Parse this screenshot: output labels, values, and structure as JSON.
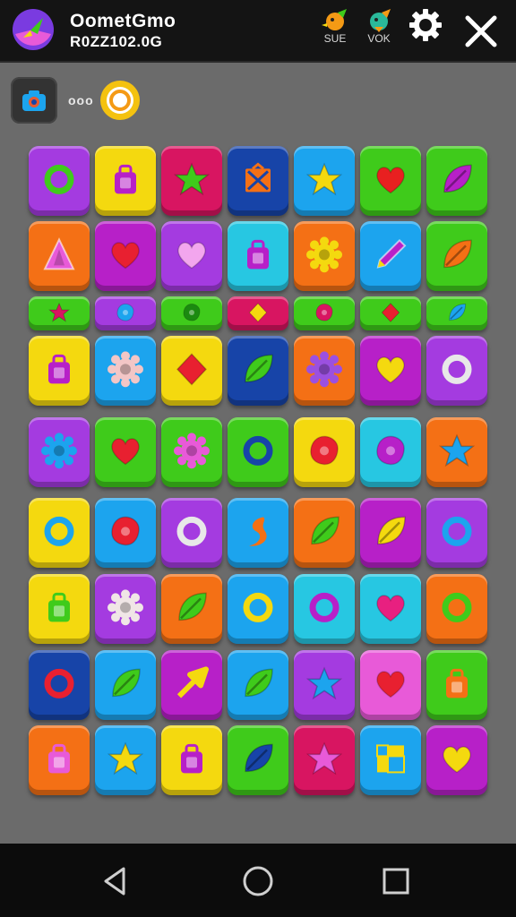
{
  "header": {
    "title": "OometGmo",
    "subtitle": "R0ZZ102.0G",
    "buttons": [
      {
        "name": "sue-button",
        "label": "SUE",
        "icon": "orange-bird-icon"
      },
      {
        "name": "vok-button",
        "label": "VOK",
        "icon": "teal-bird-icon"
      },
      {
        "name": "settings-button",
        "label": "",
        "icon": "gear-icon"
      }
    ],
    "close_icon": "close-icon"
  },
  "toolbar": {
    "camera_icon": "camera-icon",
    "dots": "ooo",
    "coin_icon": "coin-icon"
  },
  "colors": {
    "purple": "#a43be0",
    "yellow": "#f4d90f",
    "crimson": "#d81561",
    "navy": "#1744a8",
    "sky": "#1ca4ee",
    "green": "#3fcb1b",
    "orange": "#f47015",
    "magenta": "#b720c8",
    "pink": "#e85ad8",
    "cyan": "#27c7e2"
  },
  "board": {
    "rows": [
      {
        "thin": false,
        "tiles": [
          [
            "purple",
            "ring",
            "#3fcb1b"
          ],
          [
            "yellow",
            "bag",
            "#b720c8"
          ],
          [
            "crimson",
            "star",
            "#3fcb1b"
          ],
          [
            "navy",
            "box",
            "#f47015"
          ],
          [
            "sky",
            "star",
            "#f4d90f"
          ],
          [
            "green",
            "heart",
            "#e82020"
          ],
          [
            "green",
            "leaf",
            "#b720c8"
          ]
        ]
      },
      {
        "thin": false,
        "tiles": [
          [
            "orange",
            "triangle",
            "#e85ad8"
          ],
          [
            "magenta",
            "heart",
            "#e82030"
          ],
          [
            "purple",
            "heart",
            "#f3a6ee"
          ],
          [
            "cyan",
            "bag",
            "#b720c8"
          ],
          [
            "orange",
            "gear",
            "#f4d90f"
          ],
          [
            "sky",
            "pencil",
            "#b720c8"
          ],
          [
            "green",
            "leaf",
            "#f47015"
          ]
        ]
      },
      {
        "thin": true,
        "tiles": [
          [
            "green",
            "star",
            "#d81561"
          ],
          [
            "purple",
            "blob",
            "#1ca4ee"
          ],
          [
            "green",
            "blob",
            "#1b8a10"
          ],
          [
            "crimson",
            "diamond",
            "#f4d90f"
          ],
          [
            "green",
            "blob",
            "#d81561"
          ],
          [
            "green",
            "diamond",
            "#e82030"
          ],
          [
            "green",
            "leaf",
            "#1ca4ee"
          ]
        ]
      },
      {
        "thin": false,
        "tiles": [
          [
            "yellow",
            "bag",
            "#b720c8"
          ],
          [
            "sky",
            "gear",
            "#f3c6c6"
          ],
          [
            "yellow",
            "diamond",
            "#e82030"
          ],
          [
            "navy",
            "leaf",
            "#3fcb1b"
          ],
          [
            "orange",
            "gear",
            "#9b50e0"
          ],
          [
            "magenta",
            "heart",
            "#f4d90f"
          ],
          [
            "purple",
            "ring",
            "#e8e8e8"
          ]
        ]
      },
      {
        "thin": false,
        "tiles": [
          [
            "purple",
            "gear",
            "#1ca4ee"
          ],
          [
            "green",
            "heart",
            "#e82030"
          ],
          [
            "green",
            "gear",
            "#e85ad8"
          ],
          [
            "green",
            "ring",
            "#1744a8"
          ],
          [
            "yellow",
            "blob",
            "#e82030"
          ],
          [
            "cyan",
            "blob",
            "#b720c8"
          ],
          [
            "orange",
            "star",
            "#1ca4ee"
          ]
        ]
      },
      {
        "thin": false,
        "tiles": [
          [
            "yellow",
            "ring",
            "#1ca4ee"
          ],
          [
            "sky",
            "blob",
            "#e82030"
          ],
          [
            "purple",
            "ring",
            "#e8e8e8"
          ],
          [
            "sky",
            "swirl",
            "#f47015"
          ],
          [
            "orange",
            "leaf",
            "#3fcb1b"
          ],
          [
            "magenta",
            "leaf",
            "#f4d90f"
          ],
          [
            "purple",
            "ring",
            "#1ca4ee"
          ]
        ]
      },
      {
        "thin": false,
        "tiles": [
          [
            "yellow",
            "bag",
            "#3fcb1b"
          ],
          [
            "purple",
            "gear",
            "#f0e6e6"
          ],
          [
            "orange",
            "leaf",
            "#3fcb1b"
          ],
          [
            "sky",
            "ring",
            "#f4d90f"
          ],
          [
            "cyan",
            "ring",
            "#b720c8"
          ],
          [
            "cyan",
            "heart",
            "#e82080"
          ],
          [
            "orange",
            "ring",
            "#3fcb1b"
          ]
        ]
      },
      {
        "thin": false,
        "tiles": [
          [
            "navy",
            "ring",
            "#e82030"
          ],
          [
            "sky",
            "leaf",
            "#3fcb1b"
          ],
          [
            "magenta",
            "arrow",
            "#f4d90f"
          ],
          [
            "sky",
            "leaf",
            "#3fcb1b"
          ],
          [
            "purple",
            "star",
            "#1ca4ee"
          ],
          [
            "pink",
            "heart",
            "#e82030"
          ],
          [
            "green",
            "bag",
            "#f47015"
          ]
        ]
      },
      {
        "thin": false,
        "tiles": [
          [
            "orange",
            "bag",
            "#e85ad8"
          ],
          [
            "sky",
            "star",
            "#f4d90f"
          ],
          [
            "yellow",
            "bag",
            "#b720c8"
          ],
          [
            "green",
            "leaf",
            "#1744a8"
          ],
          [
            "crimson",
            "star",
            "#e85ad8"
          ],
          [
            "sky",
            "blocks",
            "#f4d90f"
          ],
          [
            "magenta",
            "heart",
            "#f4d90f"
          ]
        ]
      }
    ]
  },
  "navbar": {
    "back_icon": "back-triangle-icon",
    "home_icon": "home-circle-icon",
    "recents_icon": "recents-square-icon"
  }
}
